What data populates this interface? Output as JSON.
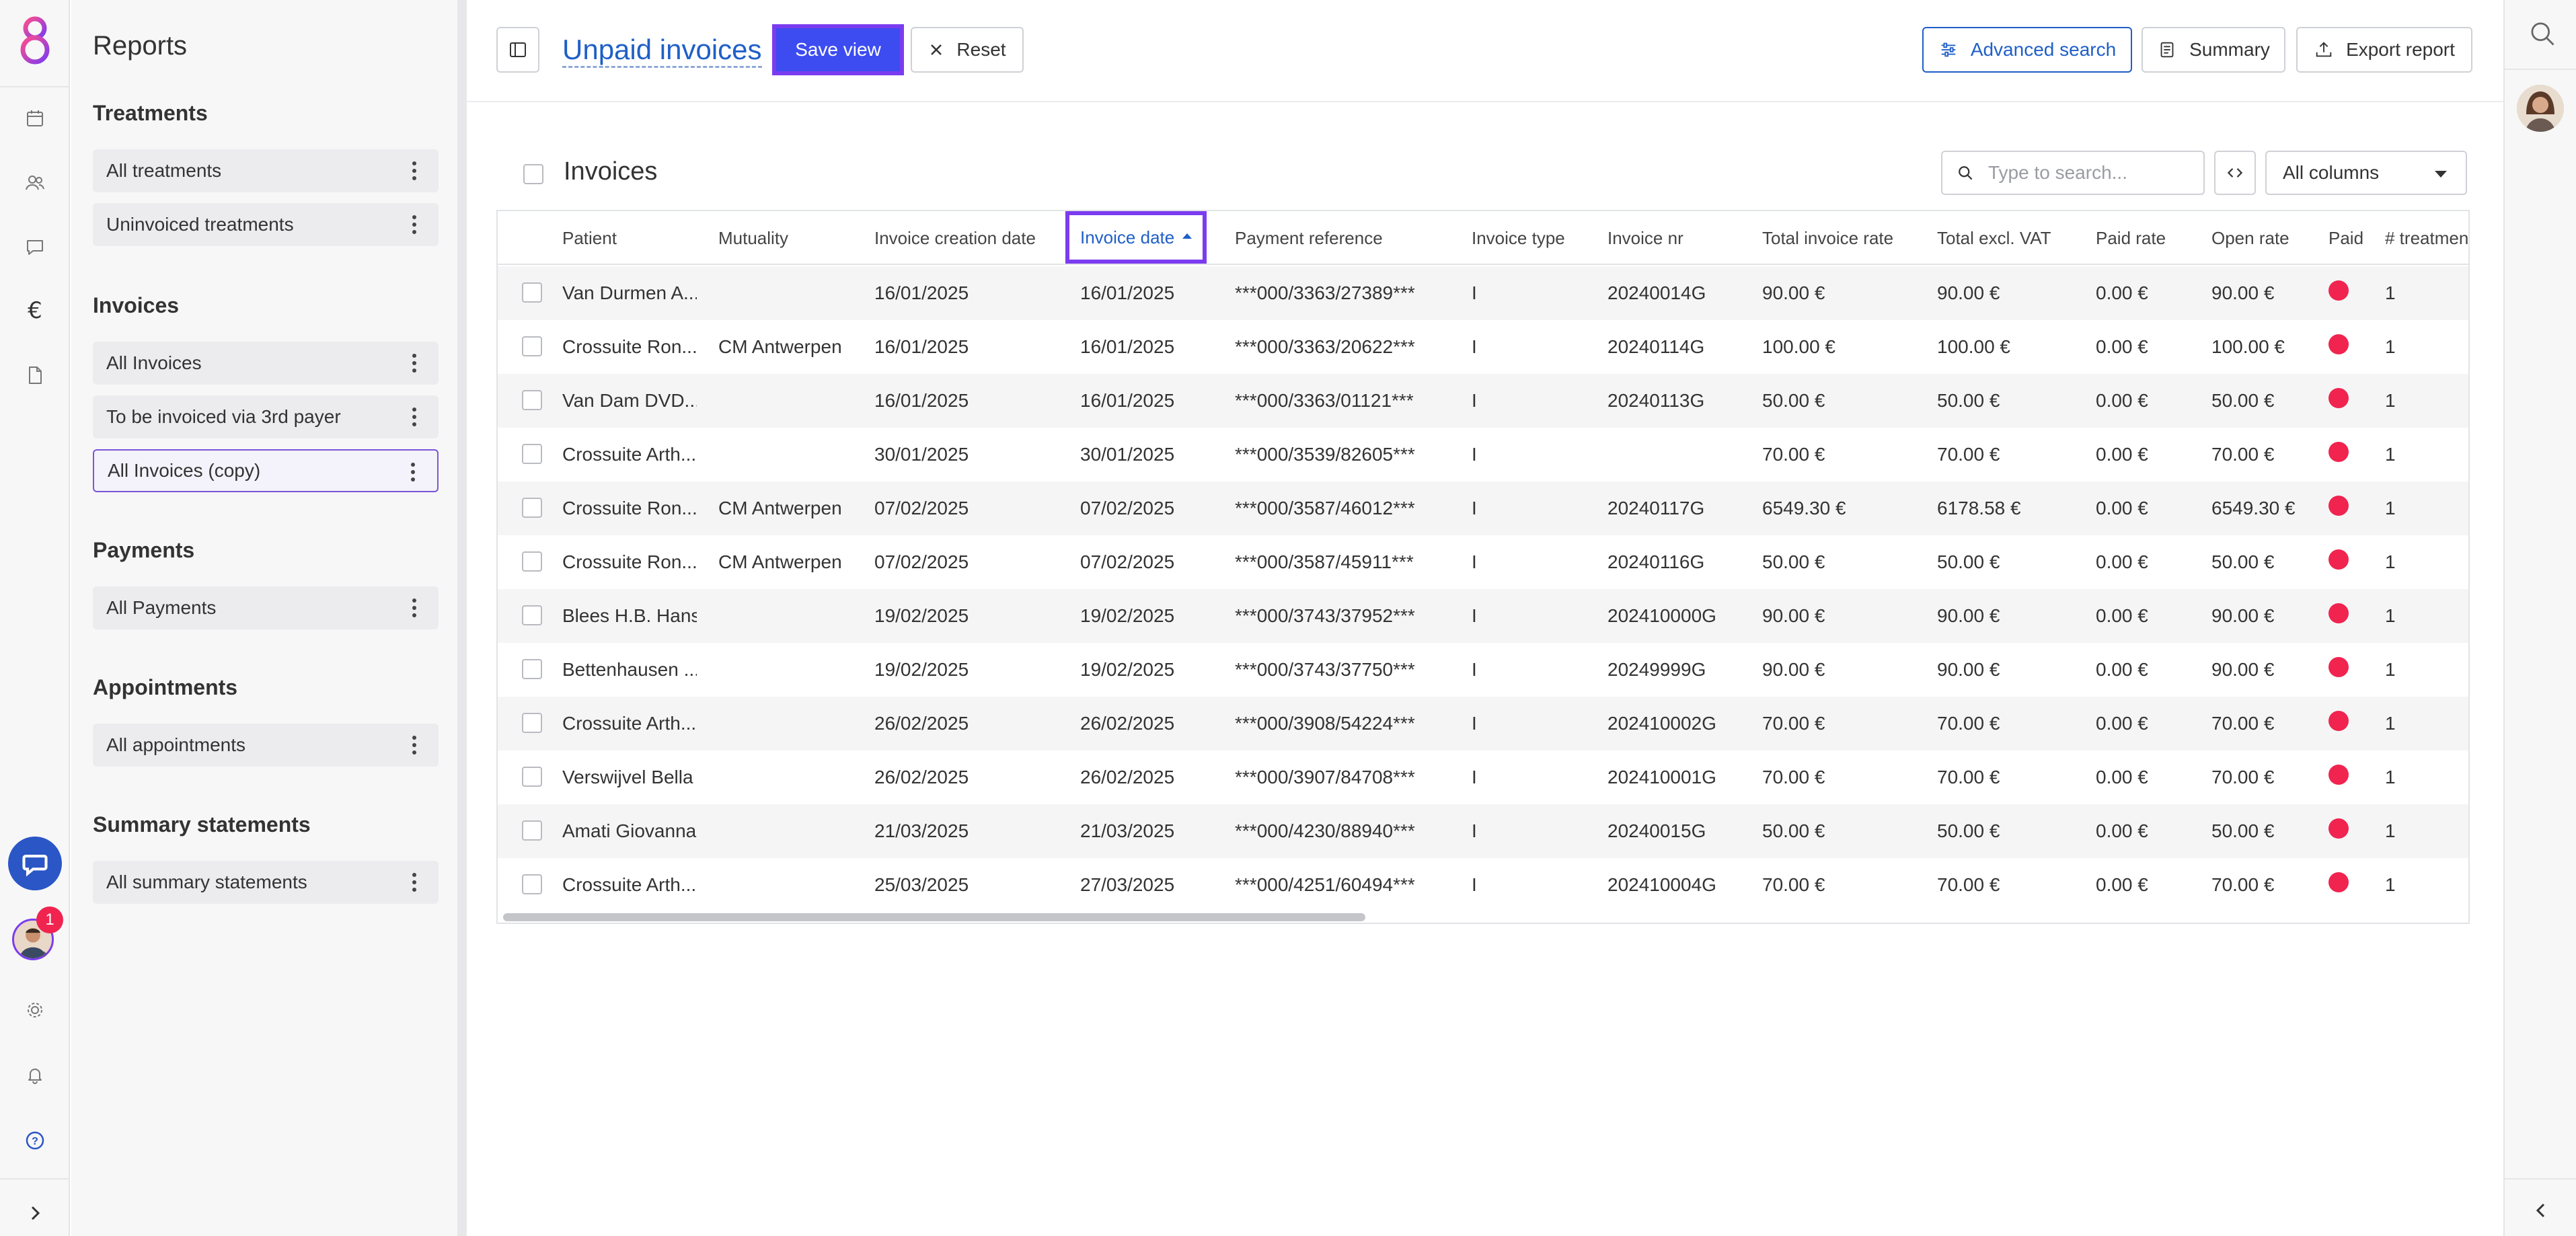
{
  "colors": {
    "accent": "#1f5fc7",
    "primary_button": "#3d4cf0",
    "highlight_border": "#7b3cf0",
    "unpaid_dot": "#f0244f",
    "badge": "#f0244f",
    "chat_bubble": "#2a56c6"
  },
  "rail": {
    "icons": [
      "brand-logo",
      "calendar-icon",
      "users-icon",
      "chat-icon",
      "euro-icon",
      "document-icon",
      "chat-support-icon",
      "avatar",
      "gear-icon",
      "bell-icon",
      "help-icon",
      "chevron-right-icon"
    ],
    "notification_count": "1"
  },
  "reports": {
    "title": "Reports",
    "sections": [
      {
        "title": "Treatments",
        "items": [
          "All treatments",
          "Uninvoiced treatments"
        ]
      },
      {
        "title": "Invoices",
        "items": [
          "All Invoices",
          "To be invoiced via 3rd payer",
          "All Invoices (copy)"
        ]
      },
      {
        "title": "Payments",
        "items": [
          "All Payments"
        ]
      },
      {
        "title": "Appointments",
        "items": [
          "All appointments"
        ]
      },
      {
        "title": "Summary statements",
        "items": [
          "All summary statements"
        ]
      }
    ]
  },
  "toolbar": {
    "view_title": "Unpaid invoices",
    "save_label": "Save view",
    "reset_label": "Reset",
    "advanced_search_label": "Advanced search",
    "summary_label": "Summary",
    "export_label": "Export report"
  },
  "table": {
    "title": "Invoices",
    "search_placeholder": "Type to search...",
    "columns_select": "All columns",
    "columns": [
      "Patient",
      "Mutuality",
      "Invoice creation date",
      "Invoice date",
      "Payment reference",
      "Invoice type",
      "Invoice nr",
      "Total invoice rate",
      "Total excl. VAT",
      "Paid rate",
      "Open rate",
      "Paid",
      "# treatmen"
    ],
    "sorted_column": "Invoice date",
    "rows": [
      [
        "Van Durmen A...",
        "",
        "16/01/2025",
        "16/01/2025",
        "***000/3363/27389***",
        "I",
        "20240014G",
        "90.00 €",
        "90.00 €",
        "0.00 €",
        "90.00 €",
        "1"
      ],
      [
        "Crossuite Ron...",
        "CM Antwerpen",
        "16/01/2025",
        "16/01/2025",
        "***000/3363/20622***",
        "I",
        "20240114G",
        "100.00 €",
        "100.00 €",
        "0.00 €",
        "100.00 €",
        "1"
      ],
      [
        "Van Dam DVD...",
        "",
        "16/01/2025",
        "16/01/2025",
        "***000/3363/01121***",
        "I",
        "20240113G",
        "50.00 €",
        "50.00 €",
        "0.00 €",
        "50.00 €",
        "1"
      ],
      [
        "Crossuite Arth...",
        "",
        "30/01/2025",
        "30/01/2025",
        "***000/3539/82605***",
        "I",
        "",
        "70.00 €",
        "70.00 €",
        "0.00 €",
        "70.00 €",
        "1"
      ],
      [
        "Crossuite Ron...",
        "CM Antwerpen",
        "07/02/2025",
        "07/02/2025",
        "***000/3587/46012***",
        "I",
        "20240117G",
        "6549.30 €",
        "6178.58 €",
        "0.00 €",
        "6549.30 €",
        "1"
      ],
      [
        "Crossuite Ron...",
        "CM Antwerpen",
        "07/02/2025",
        "07/02/2025",
        "***000/3587/45911***",
        "I",
        "20240116G",
        "50.00 €",
        "50.00 €",
        "0.00 €",
        "50.00 €",
        "1"
      ],
      [
        "Blees H.B. Hans",
        "",
        "19/02/2025",
        "19/02/2025",
        "***000/3743/37952***",
        "I",
        "202410000G",
        "90.00 €",
        "90.00 €",
        "0.00 €",
        "90.00 €",
        "1"
      ],
      [
        "Bettenhausen ...",
        "",
        "19/02/2025",
        "19/02/2025",
        "***000/3743/37750***",
        "I",
        "20249999G",
        "90.00 €",
        "90.00 €",
        "0.00 €",
        "90.00 €",
        "1"
      ],
      [
        "Crossuite Arth...",
        "",
        "26/02/2025",
        "26/02/2025",
        "***000/3908/54224***",
        "I",
        "202410002G",
        "70.00 €",
        "70.00 €",
        "0.00 €",
        "70.00 €",
        "1"
      ],
      [
        "Verswijvel Bella",
        "",
        "26/02/2025",
        "26/02/2025",
        "***000/3907/84708***",
        "I",
        "202410001G",
        "70.00 €",
        "70.00 €",
        "0.00 €",
        "70.00 €",
        "1"
      ],
      [
        "Amati Giovanna",
        "",
        "21/03/2025",
        "21/03/2025",
        "***000/4230/88940***",
        "I",
        "20240015G",
        "50.00 €",
        "50.00 €",
        "0.00 €",
        "50.00 €",
        "1"
      ],
      [
        "Crossuite Arth...",
        "",
        "25/03/2025",
        "27/03/2025",
        "***000/4251/60494***",
        "I",
        "202410004G",
        "70.00 €",
        "70.00 €",
        "0.00 €",
        "70.00 €",
        "1"
      ]
    ]
  }
}
